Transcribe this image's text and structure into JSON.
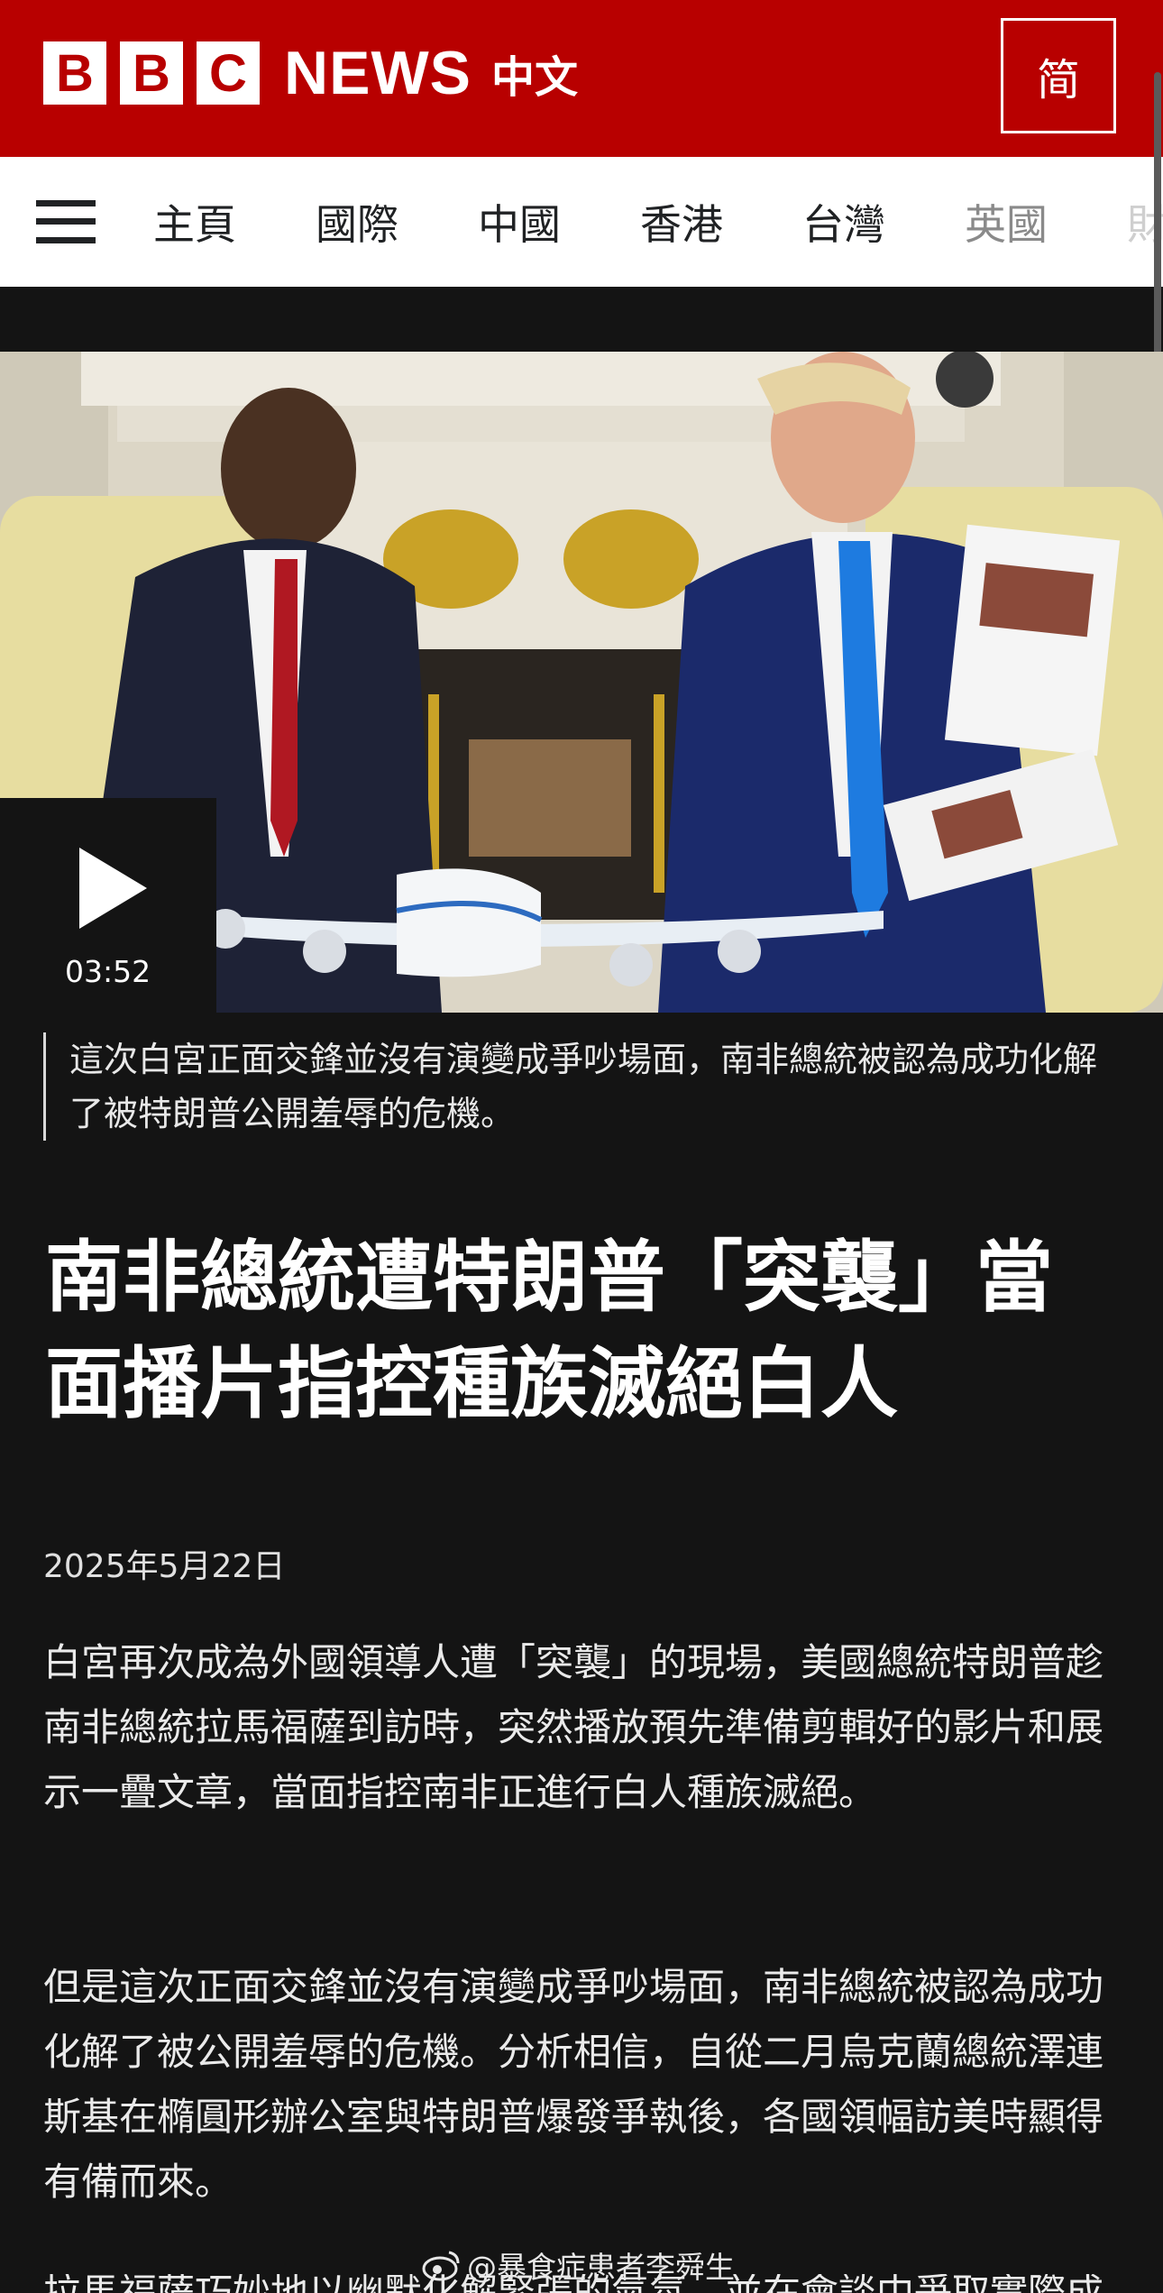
{
  "header": {
    "logo_letters": [
      "B",
      "B",
      "C"
    ],
    "logo_news": "NEWS",
    "logo_chinese": "中文",
    "script_toggle": "简",
    "brand_color": "#b80000"
  },
  "nav": {
    "items": [
      "主頁",
      "國際",
      "中國",
      "香港",
      "台灣",
      "英國",
      "財"
    ]
  },
  "video": {
    "duration": "03:52",
    "icon": "play-icon"
  },
  "article": {
    "caption": "這次白宮正面交鋒並沒有演變成爭吵場面，南非總統被認為成功化解了被特朗普公開羞辱的危機。",
    "headline": "南非總統遭特朗普「突襲」當面播片指控種族滅絕白人",
    "date": "2025年5月22日",
    "paragraphs": [
      "白宮再次成為外國領導人遭「突襲」的現場，美國總統特朗普趁南非總統拉馬福薩到訪時，突然播放預先準備剪輯好的影片和展示一疊文章，當面指控南非正進行白人種族滅絕。",
      "但是這次正面交鋒並沒有演變成爭吵場面，南非總統被認為成功化解了被公開羞辱的危機。分析相信，自從二月烏克蘭總統澤連斯基在橢圓形辦公室與特朗普爆發爭執後，各國領幅訪美時顯得有備而來。"
    ],
    "partial_next_line": "拉馬福薩巧妙地以幽默化解緊張的氣氛，並在會談中爭取實際成果。"
  },
  "watermark": {
    "text": "@暴食症患者李舜生",
    "icon": "weibo-icon"
  }
}
